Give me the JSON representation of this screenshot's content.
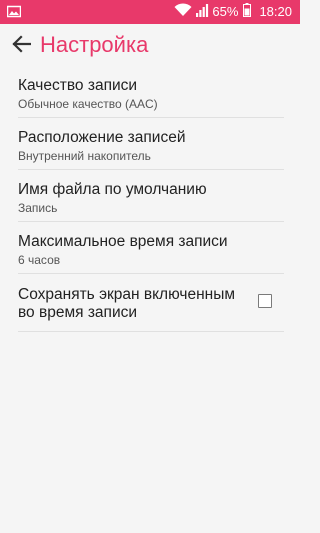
{
  "status_bar": {
    "battery_percent": "65%",
    "time": "18:20",
    "icons": [
      "notification-image-icon",
      "wifi-icon",
      "signal-icon",
      "battery-icon"
    ]
  },
  "app_bar": {
    "back_icon": "arrow-left-icon",
    "title": "Настройка"
  },
  "settings": [
    {
      "title": "Качество записи",
      "subtitle": "Обычное качество (AAC)"
    },
    {
      "title": "Расположение записей",
      "subtitle": "Внутренний накопитель"
    },
    {
      "title": "Имя файла по умолчанию",
      "subtitle": "Запись"
    },
    {
      "title": "Максимальное время записи",
      "subtitle": "6 часов"
    }
  ],
  "keep_screen_on": {
    "line1": "Сохранять экран включенным",
    "line2": "во время записи",
    "checked": false
  },
  "colors": {
    "accent": "#e8396a",
    "background": "#f5f5f5",
    "divider": "#e0e0e0"
  }
}
